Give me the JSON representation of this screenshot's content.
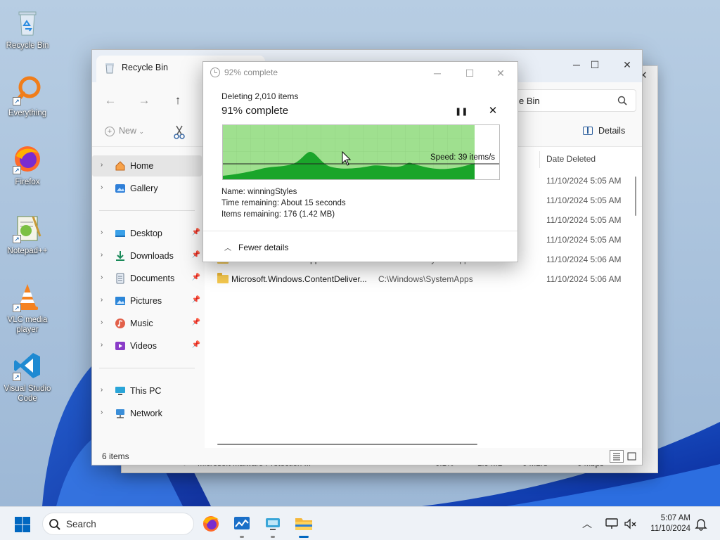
{
  "desktop": {
    "icons": [
      {
        "label": "Recycle Bin"
      },
      {
        "label": "Everything"
      },
      {
        "label": "Firefox"
      },
      {
        "label": "Notepad++"
      },
      {
        "label": "VLC media player"
      },
      {
        "label": "Visual Studio Code"
      }
    ]
  },
  "taskmgr": {
    "row_name": "Microsoft Malware Protection ...",
    "row_cpu": "0.1%",
    "row_mem": "1.9 MB",
    "row_disk": "0 MB/s",
    "row_net": "0 Mbps"
  },
  "explorer": {
    "tab_title": "Recycle Bin",
    "search_text": "e Bin",
    "new_label": "New",
    "details_label": "Details",
    "nav": {
      "home": "Home",
      "gallery": "Gallery",
      "desktop": "Desktop",
      "downloads": "Downloads",
      "documents": "Documents",
      "pictures": "Pictures",
      "music": "Music",
      "videos": "Videos",
      "thispc": "This PC",
      "network": "Network"
    },
    "column_date_deleted": "Date Deleted",
    "rows": [
      {
        "name": "",
        "location": "",
        "date": "11/10/2024 5:05 AM"
      },
      {
        "name": "",
        "location": "",
        "date": "11/10/2024 5:05 AM"
      },
      {
        "name": "",
        "location": "",
        "date": "11/10/2024 5:05 AM"
      },
      {
        "name": "",
        "location": "",
        "date": "11/10/2024 5:05 AM"
      },
      {
        "name": "Microsoft.Windows.AppResolverUX...",
        "location": "C:\\Windows\\SystemApps",
        "date": "11/10/2024 5:06 AM"
      },
      {
        "name": "Microsoft.Windows.ContentDeliver...",
        "location": "C:\\Windows\\SystemApps",
        "date": "11/10/2024 5:06 AM"
      }
    ],
    "status": "6 items"
  },
  "progress": {
    "title": "92% complete",
    "deleting": "Deleting 2,010 items",
    "complete": "91% complete",
    "speed": "Speed: 39 items/s",
    "name": "Name:  winningStyles",
    "time_remaining": "Time remaining:  About 15 seconds",
    "items_remaining": "Items remaining:  176 (1.42 MB)",
    "fewer_details": "Fewer details",
    "fraction_done": 0.91
  },
  "taskbar": {
    "search_placeholder": "Search",
    "time": "5:07 AM",
    "date": "11/10/2024"
  },
  "colors": {
    "accent": "#0067c0",
    "progress_fill": "#9fe08f",
    "graph_fill": "#1aa52a"
  }
}
